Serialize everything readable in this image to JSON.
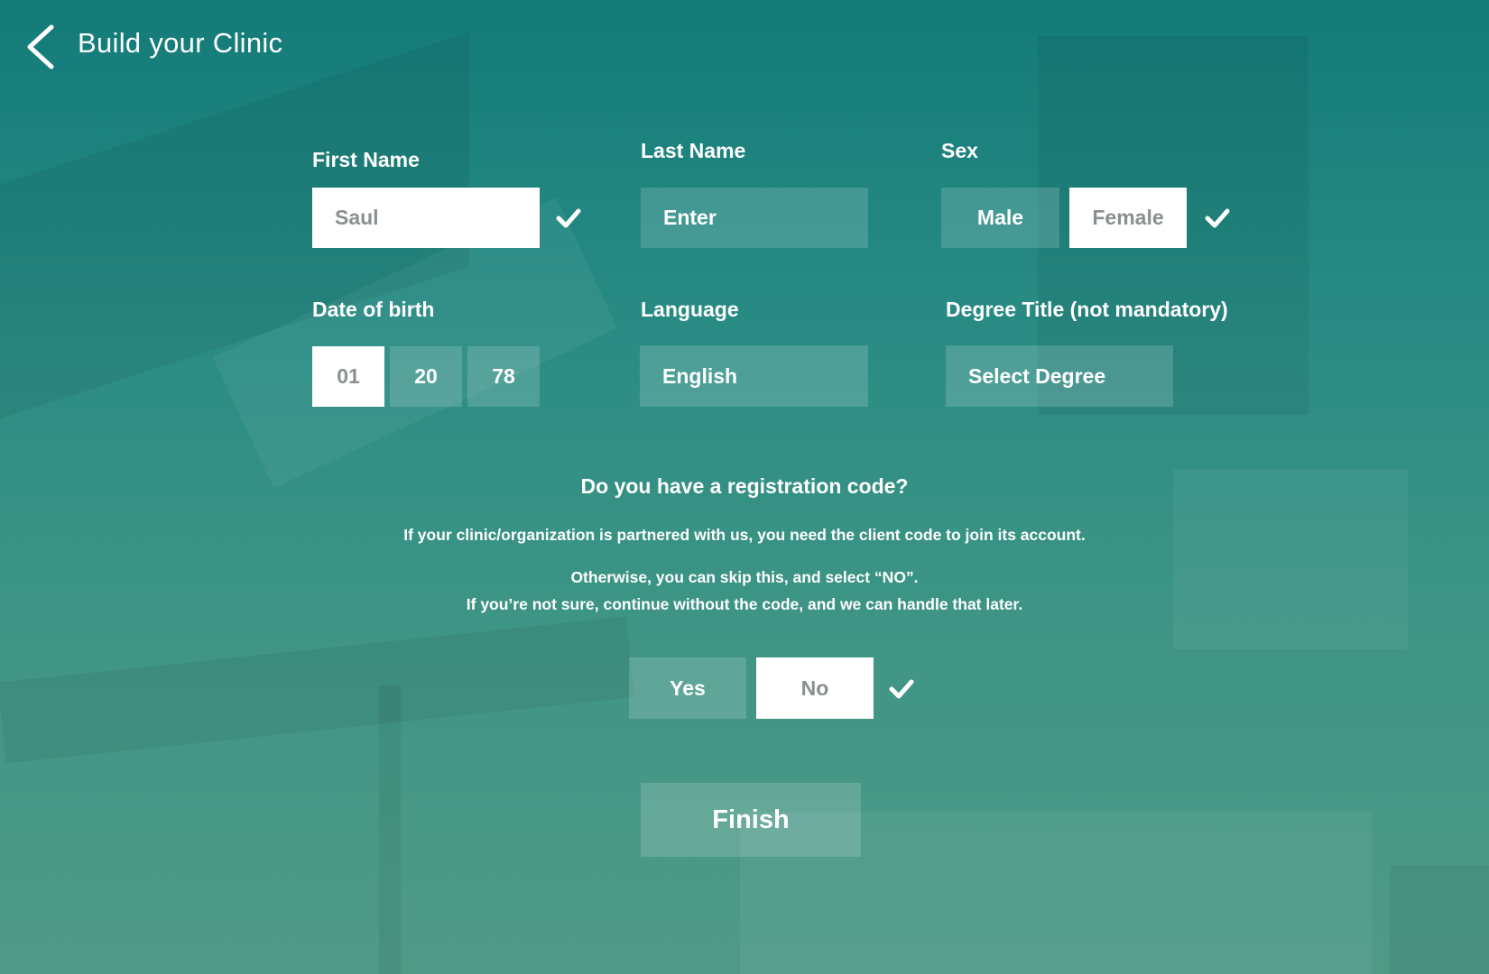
{
  "header": {
    "title": "Build your Clinic",
    "back_icon": "chevron-left-icon"
  },
  "form": {
    "first_name": {
      "label": "First Name",
      "value": "Saul",
      "valid": true
    },
    "last_name": {
      "label": "Last Name",
      "placeholder": "Enter"
    },
    "sex": {
      "label": "Sex",
      "options": [
        "Male",
        "Female"
      ],
      "selected": "Female"
    },
    "dob": {
      "label": "Date of birth",
      "month": "01",
      "day": "20",
      "year": "78"
    },
    "language": {
      "label": "Language",
      "value": "English"
    },
    "degree": {
      "label": "Degree Title (not mandatory)",
      "placeholder": "Select Degree"
    }
  },
  "registration": {
    "question": "Do you have a registration code?",
    "info_line1": "If your clinic/organization is partnered with us, you need the client code to join its account.",
    "info_line2": "Otherwise, you can skip this, and select “NO”.",
    "info_line3": "If you’re not sure, continue without the code, and we can handle that later.",
    "yes_label": "Yes",
    "no_label": "No",
    "selected": "No"
  },
  "finish_label": "Finish",
  "colors": {
    "background_top": "#137b79",
    "background_bottom": "#4f9a86",
    "selected_fill": "#ffffff",
    "selected_text": "#8a8f90",
    "unselected_fill": "rgba(255,255,255,0.16)",
    "text": "#ffffff"
  }
}
